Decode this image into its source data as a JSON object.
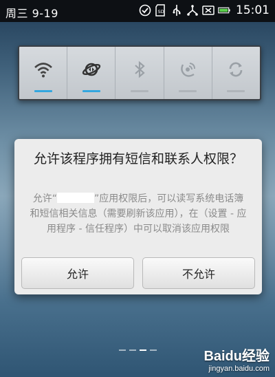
{
  "status_bar": {
    "date": "周三 9-19",
    "time": "15:01",
    "icons": [
      "check-circle-icon",
      "sd-card-icon",
      "usb-icon",
      "usb-debug-icon",
      "signal-off-icon",
      "battery-icon"
    ]
  },
  "quick_settings": {
    "tiles": [
      {
        "icon": "wifi-icon",
        "active": true
      },
      {
        "icon": "data-sync-globe-icon",
        "active": true
      },
      {
        "icon": "bluetooth-icon",
        "active": false
      },
      {
        "icon": "gps-icon",
        "active": false
      },
      {
        "icon": "auto-rotate-icon",
        "active": false
      }
    ],
    "accent_color": "#33a7df"
  },
  "dialog": {
    "title": "允许该程序拥有短信和联系人权限？",
    "message_prefix": "允许“",
    "message_rest": "”应用权限后，可以读写系统电话簿和短信相关信息（需要刷新该应用），在（设置 - 应用程序 - 信任程序）中可以取消该应用权限",
    "allow_label": "允许",
    "deny_label": "不允许"
  },
  "pager": {
    "pages": 4,
    "active": 2
  },
  "watermark": {
    "logo": "Baidu经验",
    "sub": "jingyan.baidu.com"
  }
}
